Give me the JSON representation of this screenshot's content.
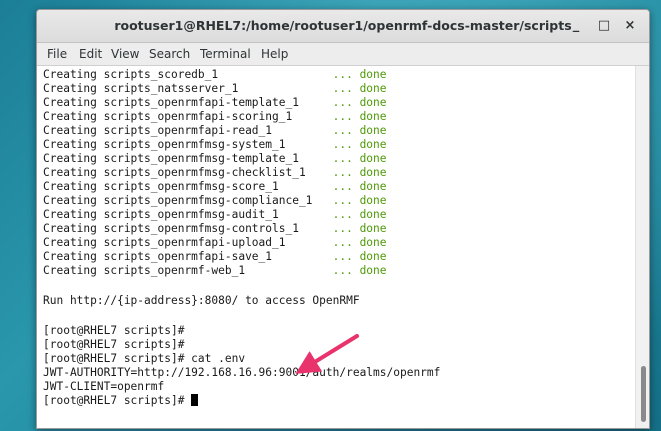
{
  "window": {
    "title": "rootuser1@RHEL7:/home/rootuser1/openrmf-docs-master/scripts",
    "minimize_glyph": "_",
    "maximize_glyph": "□",
    "close_glyph": "×"
  },
  "menu": {
    "file": "File",
    "edit": "Edit",
    "view": "View",
    "search": "Search",
    "terminal": "Terminal",
    "help": "Help"
  },
  "terminal": {
    "creating": [
      {
        "name": "Creating scripts_scoredb_1                 ",
        "status": "... done"
      },
      {
        "name": "Creating scripts_natsserver_1              ",
        "status": "... done"
      },
      {
        "name": "Creating scripts_openrmfapi-template_1     ",
        "status": "... done"
      },
      {
        "name": "Creating scripts_openrmfapi-scoring_1      ",
        "status": "... done"
      },
      {
        "name": "Creating scripts_openrmfapi-read_1         ",
        "status": "... done"
      },
      {
        "name": "Creating scripts_openrmfmsg-system_1       ",
        "status": "... done"
      },
      {
        "name": "Creating scripts_openrmfmsg-template_1     ",
        "status": "... done"
      },
      {
        "name": "Creating scripts_openrmfmsg-checklist_1    ",
        "status": "... done"
      },
      {
        "name": "Creating scripts_openrmfmsg-score_1        ",
        "status": "... done"
      },
      {
        "name": "Creating scripts_openrmfmsg-compliance_1   ",
        "status": "... done"
      },
      {
        "name": "Creating scripts_openrmfmsg-audit_1        ",
        "status": "... done"
      },
      {
        "name": "Creating scripts_openrmfmsg-controls_1     ",
        "status": "... done"
      },
      {
        "name": "Creating scripts_openrmfapi-upload_1       ",
        "status": "... done"
      },
      {
        "name": "Creating scripts_openrmfapi-save_1         ",
        "status": "... done"
      },
      {
        "name": "Creating scripts_openrmf-web_1             ",
        "status": "... done"
      }
    ],
    "run_message": "Run http://{ip-address}:8080/ to access OpenRMF",
    "prompt1": "[root@RHEL7 scripts]#",
    "prompt2": "[root@RHEL7 scripts]#",
    "prompt3": "[root@RHEL7 scripts]# cat .env",
    "env_authority": "JWT-AUTHORITY=http://192.168.16.96:9001/auth/realms/openrmf",
    "env_client": "JWT-CLIENT=openrmf",
    "prompt_final": "[root@RHEL7 scripts]# "
  },
  "colors": {
    "done": "#4e9a06",
    "annotation_arrow": "#e8336d",
    "desktop": "#1f8aa0"
  },
  "icons": {
    "annotation": "arrow-icon"
  }
}
